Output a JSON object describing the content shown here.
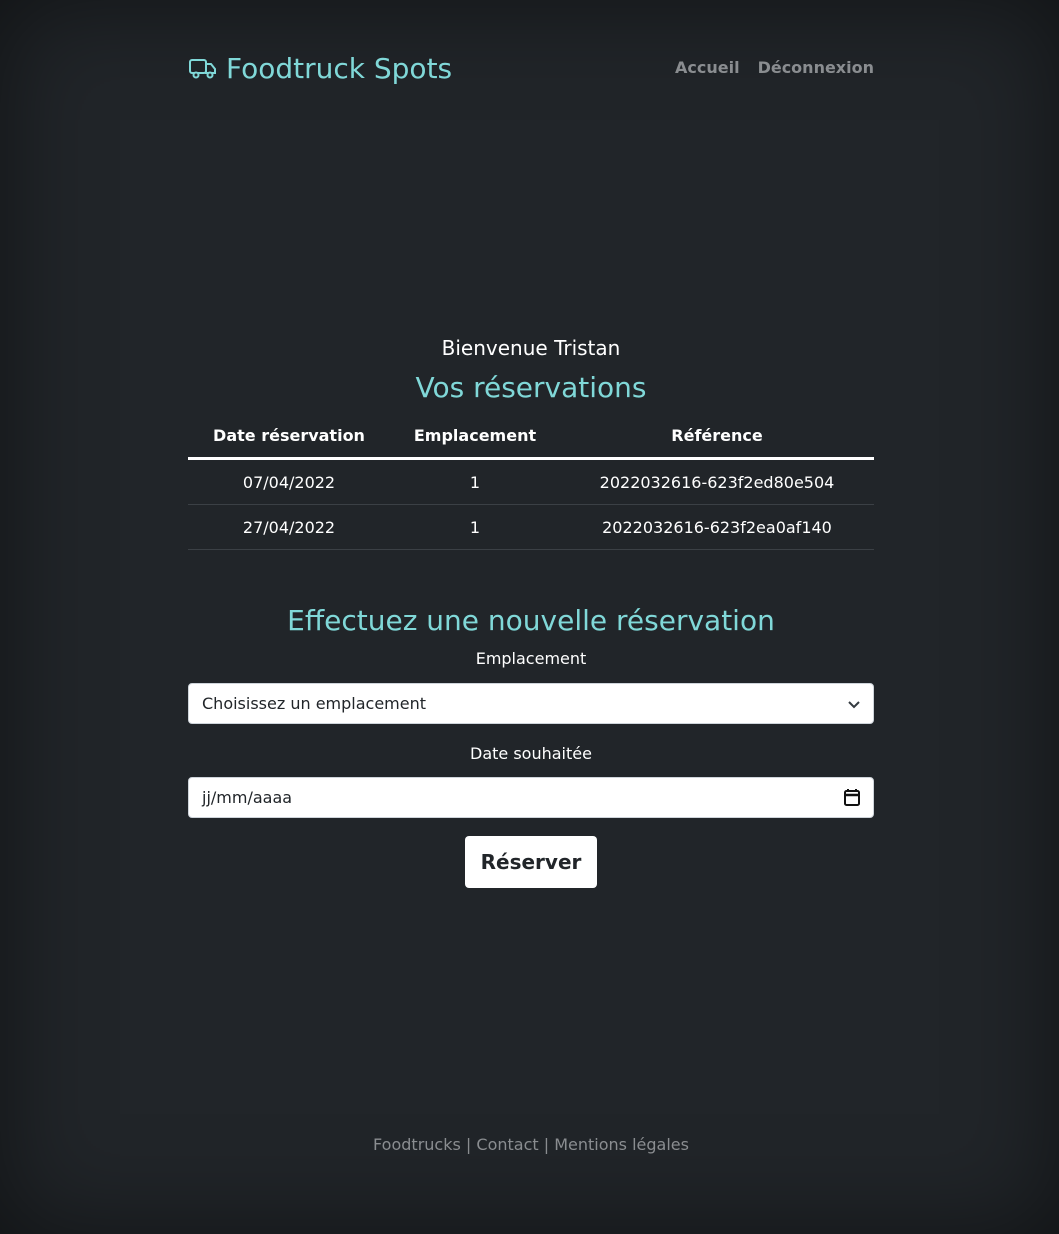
{
  "header": {
    "brand": "Foodtruck Spots",
    "nav": [
      "Accueil",
      "Déconnexion"
    ]
  },
  "main": {
    "welcome": "Bienvenue Tristan",
    "reservations_title": "Vos réservations",
    "table": {
      "headers": [
        "Date réservation",
        "Emplacement",
        "Référence"
      ],
      "rows": [
        [
          "07/04/2022",
          "1",
          "2022032616-623f2ed80e504"
        ],
        [
          "27/04/2022",
          "1",
          "2022032616-623f2ea0af140"
        ]
      ]
    }
  },
  "form": {
    "title": "Effectuez une nouvelle réservation",
    "location_label": "Emplacement",
    "location_selected": "Choisissez un emplacement",
    "date_label": "Date souhaitée",
    "date_placeholder": "jj/mm/aaaa",
    "submit_label": "Réserver"
  },
  "footer": {
    "links": [
      "Foodtrucks",
      "Contact",
      "Mentions légales"
    ],
    "separator": "|"
  },
  "colors": {
    "background": "#212529",
    "accent": "#80d8d8",
    "muted": "#8a8d90"
  }
}
